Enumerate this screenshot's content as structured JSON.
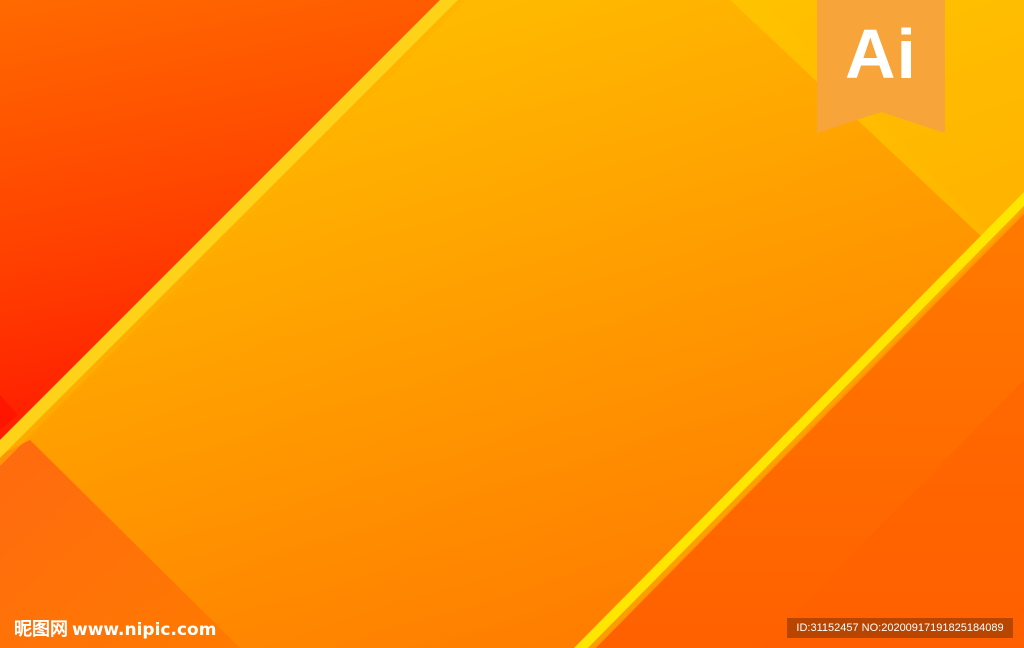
{
  "badge": {
    "label": "Ai",
    "color": "#f7a43b"
  },
  "watermark": {
    "site_cn": "昵图网",
    "site_url": "www.nipic.com"
  },
  "image_id": {
    "text": "ID:31152457 NO:20200917191825184089"
  },
  "colors": {
    "top_yellow": "#ffcc00",
    "mid_orange": "#ff8a00",
    "corner_red": "#ff1a00",
    "stripe_yellow": "#ffe000"
  }
}
